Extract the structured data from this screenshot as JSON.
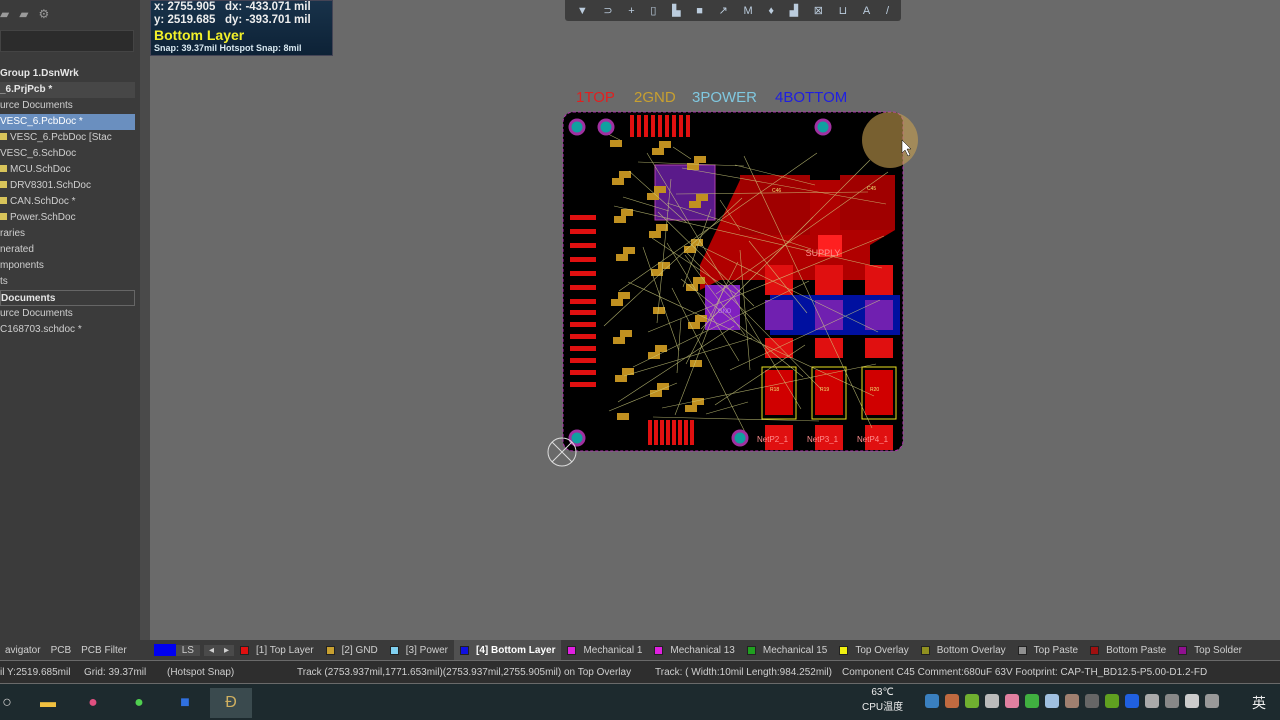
{
  "hud": {
    "x_label": "x:",
    "x": "2755.905",
    "dx_label": "dx:",
    "dx": "-433.071 mil",
    "y_label": "y:",
    "y": "2519.685",
    "dy_label": "dy:",
    "dy": "-393.701 mil",
    "layer": "Bottom Layer",
    "snap": "Snap: 39.37mil Hotspot Snap: 8mil"
  },
  "project_tree": [
    {
      "label": "Group 1.DsnWrk",
      "style": "bold"
    },
    {
      "label": "_6.PrjPcb *",
      "style": "bold hdr"
    },
    {
      "label": "urce Documents",
      "style": ""
    },
    {
      "label": "VESC_6.PcbDoc *",
      "style": "sel"
    },
    {
      "label": "VESC_6.PcbDoc [Stac",
      "style": "",
      "icon": true
    },
    {
      "label": "VESC_6.SchDoc",
      "style": ""
    },
    {
      "label": "MCU.SchDoc",
      "style": "",
      "icon": true
    },
    {
      "label": "DRV8301.SchDoc",
      "style": "",
      "icon": true
    },
    {
      "label": "CAN.SchDoc *",
      "style": "",
      "icon": true
    },
    {
      "label": "Power.SchDoc",
      "style": "",
      "icon": true
    },
    {
      "label": "raries",
      "style": ""
    },
    {
      "label": "nerated",
      "style": ""
    },
    {
      "label": "mponents",
      "style": ""
    },
    {
      "label": "ts",
      "style": ""
    },
    {
      "label": "Documents",
      "style": "bold box"
    },
    {
      "label": "urce Documents",
      "style": ""
    },
    {
      "label": "C168703.schdoc *",
      "style": ""
    }
  ],
  "board_legend": [
    {
      "label": "1TOP",
      "color": "#e02020"
    },
    {
      "label": "2GND",
      "color": "#c8a030"
    },
    {
      "label": "3POWER",
      "color": "#80c8e0"
    },
    {
      "label": "4BOTTOM",
      "color": "#2020e0"
    }
  ],
  "board_labels": {
    "supply": "SUPPLY",
    "net2": "NetP2_1",
    "net3": "NetP3_1",
    "net4": "NetP4_1",
    "r18": "R18",
    "r19": "R19",
    "r20": "R20",
    "c46": "C46",
    "c45": "C45",
    "gnd": "GND"
  },
  "toolbar_icons": [
    "filter-icon",
    "magnet-icon",
    "cross-icon",
    "rect-icon",
    "bar-chart-icon",
    "square-icon",
    "route-icon",
    "m-icon",
    "pin-icon",
    "stairs-icon",
    "box-line-icon",
    "frame-icon",
    "text-icon",
    "pencil-icon"
  ],
  "panel_tabs": [
    "avigator",
    "PCB",
    "PCB Filter"
  ],
  "ls_label": "LS",
  "layers": [
    {
      "label": "[1] Top Layer",
      "color": "#e01010"
    },
    {
      "label": "[2] GND",
      "color": "#c8a030"
    },
    {
      "label": "[3] Power",
      "color": "#80d0f0"
    },
    {
      "label": "[4] Bottom Layer",
      "color": "#1010e0",
      "active": true
    },
    {
      "label": "Mechanical 1",
      "color": "#e020e0"
    },
    {
      "label": "Mechanical 13",
      "color": "#e020e0"
    },
    {
      "label": "Mechanical 15",
      "color": "#20a020"
    },
    {
      "label": "Top Overlay",
      "color": "#f0f010"
    },
    {
      "label": "Bottom Overlay",
      "color": "#909020"
    },
    {
      "label": "Top Paste",
      "color": "#909090"
    },
    {
      "label": "Bottom Paste",
      "color": "#a01010"
    },
    {
      "label": "Top Solder",
      "color": "#901090"
    }
  ],
  "status": {
    "coord": "il Y:2519.685mil",
    "grid": "Grid: 39.37mil",
    "snap": "(Hotspot Snap)",
    "track": "Track (2753.937mil,1771.653mil)(2753.937mil,2755.905mil) on Top Overlay",
    "track_info": "Track: ( Width:10mil Length:984.252mil)",
    "component": "Component C45 Comment:680uF 63V Footprint: CAP-TH_BD12.5-P5.00-D1.2-FD"
  },
  "taskbar": {
    "cpu_temp": "63℃",
    "cpu_label": "CPU温度",
    "ime": "英"
  }
}
